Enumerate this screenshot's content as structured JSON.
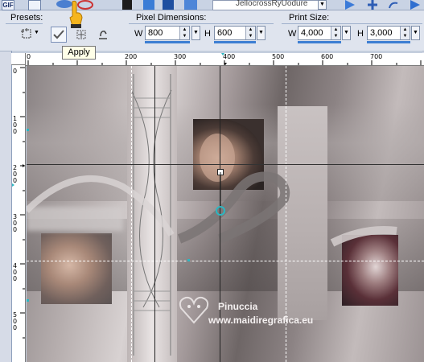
{
  "toolbar": {
    "gif_icon_label": "GIF",
    "preset_field_text": "JellocrossRyUodure"
  },
  "options": {
    "presets_label": "Presets:",
    "pixel_dimensions_label": "Pixel Dimensions:",
    "print_size_label": "Print Size:",
    "pixel_width": {
      "prefix": "W",
      "value": "800"
    },
    "pixel_height": {
      "prefix": "H",
      "value": "600"
    },
    "print_width": {
      "prefix": "W",
      "value": "4,000"
    },
    "print_height": {
      "prefix": "H",
      "value": "3,000"
    }
  },
  "tooltip": "Apply",
  "ruler": {
    "horizontal_ticks": [
      "0",
      "100",
      "200",
      "300",
      "400",
      "500",
      "600",
      "700"
    ],
    "vertical_ticks": [
      {
        "digits": [
          "0"
        ]
      },
      {
        "digits": [
          "1",
          "0",
          "0"
        ]
      },
      {
        "digits": [
          "2",
          "0",
          "0"
        ]
      },
      {
        "digits": [
          "3",
          "0",
          "0"
        ]
      },
      {
        "digits": [
          "4",
          "0",
          "0"
        ]
      },
      {
        "digits": [
          "5",
          "0",
          "0"
        ]
      }
    ]
  },
  "watermark": {
    "line1": "Pinuccia",
    "line2": "www.maidiregrafica.eu"
  },
  "colors": {
    "accent_blue": "#3d7fd3",
    "cyan_node": "#2bb7c2",
    "guide": "#ffffff"
  }
}
